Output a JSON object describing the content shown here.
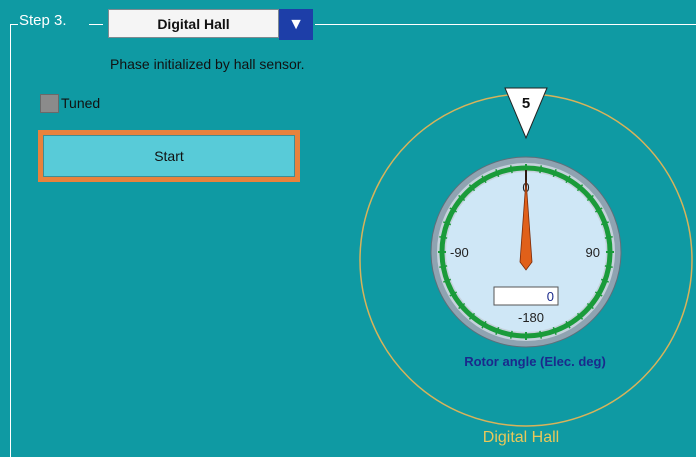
{
  "step": {
    "label": "Step 3."
  },
  "mode_select": {
    "selected": "Digital Hall"
  },
  "status_text": "Phase initialized by hall sensor.",
  "tuned": {
    "label": "Tuned"
  },
  "start_button": {
    "label": "Start"
  },
  "gauge": {
    "marker_value": "5",
    "readout_value": "0",
    "tick_labels": {
      "top": "0",
      "left": "-90",
      "right": "90",
      "bottom": "-180"
    },
    "title": "Rotor angle (Elec. deg)",
    "caption": "Digital Hall",
    "needle_angle_deg": 0
  },
  "colors": {
    "panel": "#0f9aa3",
    "gauge_ring": "#d8b35a",
    "dial_face": "#cfe7f6",
    "dial_green": "#1a9b3a",
    "needle": "#e0601a",
    "title_blue": "#1a2a8c",
    "caption": "#e8c85a",
    "start_border": "#e8823c",
    "start_fill": "#58cbd8",
    "dropdown_button": "#1d3ea8"
  }
}
